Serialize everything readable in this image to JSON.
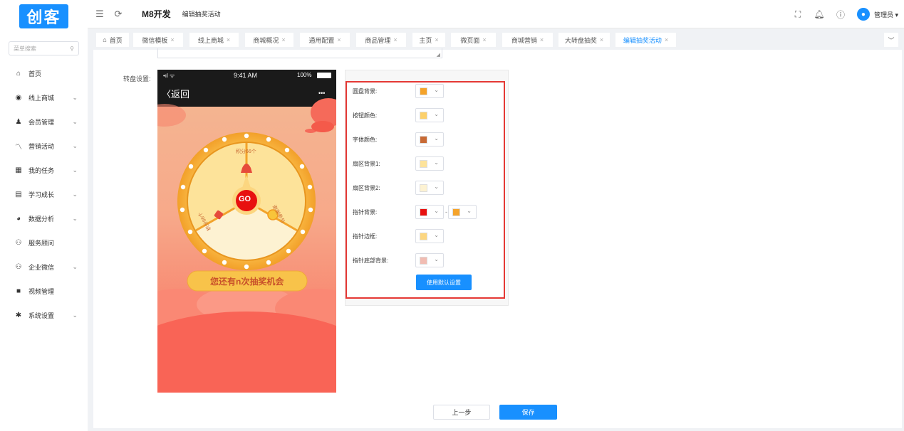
{
  "logo": {
    "text": "创客"
  },
  "topbar": {
    "app_name": "M8开发",
    "page_name": "编辑抽奖活动",
    "user": "管理员"
  },
  "sidebar": {
    "search_placeholder": "菜单搜索",
    "items": [
      {
        "label": "首页",
        "icon": "home-icon",
        "has_children": false
      },
      {
        "label": "线上商城",
        "icon": "store-icon",
        "has_children": true
      },
      {
        "label": "会员管理",
        "icon": "user-icon",
        "has_children": true
      },
      {
        "label": "营销活动",
        "icon": "trend-icon",
        "has_children": true
      },
      {
        "label": "我的任务",
        "icon": "grid-icon",
        "has_children": true
      },
      {
        "label": "学习成长",
        "icon": "book-icon",
        "has_children": true
      },
      {
        "label": "数据分析",
        "icon": "pie-icon",
        "has_children": true
      },
      {
        "label": "服务顾问",
        "icon": "people-icon",
        "has_children": false
      },
      {
        "label": "企业微信",
        "icon": "people-icon",
        "has_children": true
      },
      {
        "label": "视频管理",
        "icon": "video-icon",
        "has_children": false
      },
      {
        "label": "系统设置",
        "icon": "gear-icon",
        "has_children": true
      }
    ]
  },
  "tabs": [
    {
      "label": "首页",
      "closable": false,
      "active": false
    },
    {
      "label": "微信模板",
      "closable": true,
      "active": false
    },
    {
      "label": "线上商城",
      "closable": true,
      "active": false
    },
    {
      "label": "商城概况",
      "closable": true,
      "active": false
    },
    {
      "label": "通用配置",
      "closable": true,
      "active": false
    },
    {
      "label": "商品管理",
      "closable": true,
      "active": false
    },
    {
      "label": "主页",
      "closable": true,
      "active": false
    },
    {
      "label": "微页面",
      "closable": true,
      "active": false
    },
    {
      "label": "商城营销",
      "closable": true,
      "active": false
    },
    {
      "label": "大转盘抽奖",
      "closable": true,
      "active": false
    },
    {
      "label": "编辑抽奖活动",
      "closable": true,
      "active": true
    }
  ],
  "form": {
    "wheel_label": "转盘设置:"
  },
  "phone": {
    "signal": "•ıl ᯤ",
    "time": "9:41 AM",
    "battery": "100%",
    "back": "返回",
    "more": "•••",
    "prizes": [
      "积分66个",
      "谢谢参与",
      "积分66个"
    ],
    "go": "GO",
    "chances": "您还有n次抽奖机会"
  },
  "colors": {
    "title": "",
    "rows": [
      {
        "label": "圆盘背景:",
        "colors": [
          "#f5a32a"
        ]
      },
      {
        "label": "按钮颜色:",
        "colors": [
          "#fcd06a"
        ]
      },
      {
        "label": "字体颜色:",
        "colors": [
          "#c86a35"
        ]
      },
      {
        "label": "扇区背景1:",
        "colors": [
          "#fde39a"
        ]
      },
      {
        "label": "扇区背景2:",
        "colors": [
          "#fdf2d2"
        ]
      },
      {
        "label": "指针背景:",
        "colors": [
          "#e8100f",
          "#f5a32a"
        ]
      },
      {
        "label": "指针边框:",
        "colors": [
          "#fcd680"
        ]
      },
      {
        "label": "指针底部背景:",
        "colors": [
          "#f1bcb2"
        ]
      }
    ],
    "default_button": "使用默认设置"
  },
  "footer": {
    "prev": "上一步",
    "save": "保存"
  },
  "accent": "#1890ff"
}
